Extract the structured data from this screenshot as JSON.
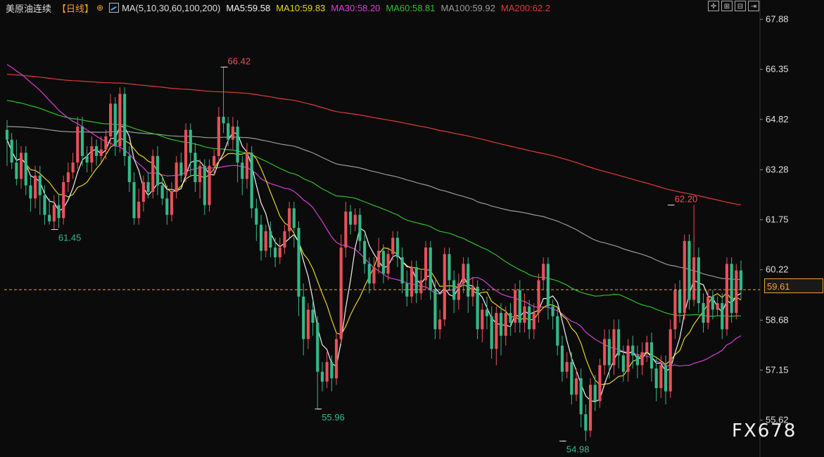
{
  "legend": {
    "symbol": "美原油连续",
    "period": "【日线】",
    "ma_label": "MA(5,10,30,60,100,200)",
    "ma5": "MA5:59.58",
    "ma10": "MA10:59.83",
    "ma30": "MA30:58.20",
    "ma60": "MA60:58.81",
    "ma100": "MA100:59.92",
    "ma200": "MA200:62.2"
  },
  "colors": {
    "background": "#0b0b0b",
    "up": "#e8505b",
    "down": "#34b888",
    "ma5": "#f2f2f2",
    "ma10": "#e6d320",
    "ma30": "#d63fd6",
    "ma60": "#2fbf2f",
    "ma100": "#9a9a9a",
    "ma200": "#e03a3a",
    "current_price": "#f0a030"
  },
  "current_price": "59.61",
  "watermark": "FX678",
  "chart_data": {
    "type": "candlestick",
    "ylim": [
      54.6,
      68.3
    ],
    "y_ticks": [
      "67.88",
      "66.35",
      "64.82",
      "63.28",
      "61.75",
      "60.22",
      "58.68",
      "57.15",
      "55.62"
    ],
    "current_price": 59.61,
    "annotations": [
      {
        "text": "66.42",
        "index": 46,
        "value": 66.42,
        "kind": "high"
      },
      {
        "text": "61.45",
        "index": 10,
        "value": 61.45,
        "kind": "low"
      },
      {
        "text": "55.96",
        "index": 66,
        "value": 55.96,
        "kind": "low"
      },
      {
        "text": "54.98",
        "index": 118,
        "value": 54.98,
        "kind": "low"
      },
      {
        "text": "62.20",
        "index": 141,
        "value": 62.2,
        "kind": "high"
      }
    ],
    "candles": [
      [
        64.5,
        64.2,
        64.8,
        63.4
      ],
      [
        64.2,
        63.5,
        64.4,
        63.3
      ],
      [
        63.5,
        63.0,
        64.2,
        62.8
      ],
      [
        63.0,
        63.8,
        64.0,
        62.7
      ],
      [
        63.8,
        62.8,
        64.0,
        62.5
      ],
      [
        62.8,
        62.4,
        63.1,
        62.0
      ],
      [
        62.4,
        63.1,
        63.4,
        62.1
      ],
      [
        63.1,
        62.5,
        63.4,
        61.9
      ],
      [
        62.5,
        61.9,
        62.8,
        61.6
      ],
      [
        61.9,
        61.7,
        62.4,
        61.6
      ],
      [
        61.7,
        62.2,
        62.5,
        61.45
      ],
      [
        62.2,
        61.8,
        62.5,
        61.5
      ],
      [
        61.8,
        62.9,
        63.1,
        61.6
      ],
      [
        62.9,
        63.2,
        63.5,
        62.6
      ],
      [
        63.2,
        63.5,
        63.8,
        63.0
      ],
      [
        63.5,
        64.6,
        64.9,
        63.3
      ],
      [
        64.6,
        63.7,
        64.9,
        63.4
      ],
      [
        63.7,
        63.5,
        64.0,
        63.2
      ],
      [
        63.5,
        64.0,
        64.3,
        63.2
      ],
      [
        64.0,
        63.7,
        64.2,
        63.4
      ],
      [
        63.7,
        63.9,
        64.3,
        63.5
      ],
      [
        63.9,
        64.3,
        64.5,
        63.6
      ],
      [
        64.3,
        65.3,
        65.6,
        64.0
      ],
      [
        65.3,
        64.0,
        65.5,
        63.7
      ],
      [
        64.0,
        65.6,
        65.8,
        63.8
      ],
      [
        65.6,
        63.7,
        65.8,
        63.4
      ],
      [
        63.7,
        62.9,
        64.0,
        62.6
      ],
      [
        62.9,
        61.8,
        63.2,
        61.6
      ],
      [
        61.8,
        62.3,
        62.7,
        61.6
      ],
      [
        62.3,
        62.9,
        63.1,
        62.0
      ],
      [
        62.9,
        62.6,
        63.2,
        62.4
      ],
      [
        62.6,
        63.7,
        63.9,
        62.4
      ],
      [
        63.7,
        62.8,
        64.0,
        62.5
      ],
      [
        62.8,
        62.4,
        63.1,
        62.2
      ],
      [
        62.4,
        61.9,
        62.8,
        61.6
      ],
      [
        61.9,
        62.6,
        62.9,
        61.7
      ],
      [
        62.6,
        63.5,
        63.7,
        62.4
      ],
      [
        63.5,
        63.1,
        63.8,
        62.9
      ],
      [
        63.1,
        64.5,
        64.7,
        62.9
      ],
      [
        64.5,
        63.8,
        64.7,
        63.1
      ],
      [
        63.8,
        62.9,
        64.1,
        62.6
      ],
      [
        62.9,
        63.4,
        63.6,
        62.4
      ],
      [
        63.4,
        62.2,
        63.6,
        61.9
      ],
      [
        62.2,
        63.4,
        63.6,
        62.0
      ],
      [
        63.4,
        63.7,
        63.9,
        63.1
      ],
      [
        63.7,
        64.9,
        65.2,
        63.5
      ],
      [
        64.9,
        64.7,
        66.42,
        64.4
      ],
      [
        64.7,
        64.2,
        64.9,
        64.0
      ],
      [
        64.2,
        64.6,
        64.9,
        63.9
      ],
      [
        64.6,
        63.5,
        64.8,
        62.9
      ],
      [
        63.5,
        63.0,
        63.7,
        62.5
      ],
      [
        63.0,
        63.8,
        64.1,
        62.7
      ],
      [
        63.8,
        62.1,
        64.0,
        61.8
      ],
      [
        62.1,
        61.6,
        62.4,
        61.1
      ],
      [
        61.6,
        60.8,
        61.9,
        60.5
      ],
      [
        60.8,
        61.4,
        61.6,
        60.6
      ],
      [
        61.4,
        60.9,
        61.7,
        60.6
      ],
      [
        60.9,
        60.6,
        61.2,
        60.3
      ],
      [
        60.6,
        60.9,
        61.2,
        60.4
      ],
      [
        60.9,
        61.4,
        61.6,
        60.7
      ],
      [
        61.4,
        62.1,
        62.3,
        61.2
      ],
      [
        62.1,
        61.5,
        62.3,
        60.9
      ],
      [
        61.5,
        59.4,
        61.7,
        58.8
      ],
      [
        59.4,
        58.1,
        59.8,
        57.6
      ],
      [
        58.1,
        59.0,
        59.2,
        57.8
      ],
      [
        59.0,
        58.6,
        59.3,
        58.2
      ],
      [
        58.6,
        57.1,
        58.8,
        55.96
      ],
      [
        57.1,
        56.8,
        57.4,
        56.5
      ],
      [
        56.8,
        57.4,
        57.7,
        56.6
      ],
      [
        57.4,
        56.9,
        57.6,
        56.5
      ],
      [
        56.9,
        58.1,
        58.3,
        56.7
      ],
      [
        58.1,
        60.9,
        61.3,
        57.9
      ],
      [
        60.9,
        62.0,
        62.3,
        60.6
      ],
      [
        62.0,
        61.6,
        62.2,
        61.3
      ],
      [
        61.6,
        61.9,
        62.1,
        61.4
      ],
      [
        61.9,
        61.1,
        62.1,
        60.8
      ],
      [
        61.1,
        60.4,
        61.3,
        60.1
      ],
      [
        60.4,
        59.8,
        60.6,
        59.5
      ],
      [
        59.8,
        60.3,
        60.6,
        59.6
      ],
      [
        60.3,
        60.8,
        61.2,
        60.1
      ],
      [
        60.8,
        60.1,
        61.0,
        59.8
      ],
      [
        60.1,
        60.7,
        60.9,
        59.9
      ],
      [
        60.7,
        61.2,
        61.4,
        60.5
      ],
      [
        61.2,
        60.6,
        61.4,
        60.3
      ],
      [
        60.6,
        59.8,
        60.9,
        59.5
      ],
      [
        59.8,
        59.4,
        60.2,
        59.1
      ],
      [
        59.4,
        60.3,
        60.5,
        59.2
      ],
      [
        60.3,
        59.5,
        60.5,
        59.2
      ],
      [
        59.5,
        59.9,
        60.2,
        59.3
      ],
      [
        59.9,
        60.9,
        61.1,
        59.6
      ],
      [
        60.9,
        59.6,
        61.1,
        59.3
      ],
      [
        59.6,
        58.4,
        59.9,
        58.1
      ],
      [
        58.4,
        58.7,
        59.0,
        58.1
      ],
      [
        58.7,
        60.7,
        60.9,
        58.5
      ],
      [
        60.7,
        59.9,
        60.9,
        59.6
      ],
      [
        59.9,
        59.3,
        60.2,
        58.9
      ],
      [
        59.3,
        59.8,
        60.1,
        59.0
      ],
      [
        59.8,
        60.4,
        60.6,
        59.5
      ],
      [
        60.4,
        59.4,
        60.6,
        58.9
      ],
      [
        59.4,
        59.7,
        60.0,
        59.1
      ],
      [
        59.7,
        58.4,
        59.9,
        58.1
      ],
      [
        58.4,
        59.0,
        59.2,
        58.0
      ],
      [
        59.0,
        58.8,
        59.4,
        58.4
      ],
      [
        58.8,
        57.8,
        59.1,
        57.5
      ],
      [
        57.8,
        58.9,
        59.1,
        57.3
      ],
      [
        58.9,
        58.2,
        59.2,
        57.6
      ],
      [
        58.2,
        58.9,
        59.1,
        57.9
      ],
      [
        58.9,
        58.6,
        59.2,
        58.2
      ],
      [
        58.6,
        59.6,
        59.8,
        58.3
      ],
      [
        59.6,
        58.6,
        59.9,
        58.3
      ],
      [
        58.6,
        59.1,
        59.5,
        58.3
      ],
      [
        59.1,
        58.4,
        59.3,
        58.1
      ],
      [
        58.4,
        58.9,
        59.2,
        58.1
      ],
      [
        58.9,
        59.9,
        60.1,
        58.6
      ],
      [
        59.9,
        60.4,
        60.6,
        59.6
      ],
      [
        60.4,
        59.1,
        60.6,
        58.7
      ],
      [
        59.1,
        58.8,
        59.3,
        58.4
      ],
      [
        58.8,
        57.9,
        59.1,
        57.6
      ],
      [
        57.9,
        57.1,
        58.2,
        56.8
      ],
      [
        57.1,
        57.4,
        57.7,
        56.9
      ],
      [
        57.4,
        56.4,
        57.7,
        56.1
      ],
      [
        56.4,
        56.9,
        57.2,
        56.2
      ],
      [
        56.9,
        55.8,
        57.2,
        55.4
      ],
      [
        55.8,
        55.3,
        56.1,
        54.98
      ],
      [
        55.3,
        56.7,
        56.9,
        55.1
      ],
      [
        56.7,
        56.2,
        57.0,
        55.9
      ],
      [
        56.2,
        57.3,
        57.5,
        56.0
      ],
      [
        57.3,
        58.1,
        58.4,
        57.0
      ],
      [
        58.1,
        57.3,
        58.4,
        56.9
      ],
      [
        57.3,
        58.4,
        58.7,
        57.0
      ],
      [
        58.4,
        57.6,
        58.7,
        57.2
      ],
      [
        57.6,
        57.1,
        57.9,
        56.8
      ],
      [
        57.1,
        57.9,
        58.1,
        56.8
      ],
      [
        57.9,
        57.6,
        58.2,
        57.2
      ],
      [
        57.6,
        57.3,
        57.9,
        56.9
      ],
      [
        57.3,
        57.7,
        58.0,
        57.0
      ],
      [
        57.7,
        58.0,
        58.2,
        57.4
      ],
      [
        58.0,
        57.2,
        58.3,
        56.8
      ],
      [
        57.2,
        56.6,
        57.5,
        56.2
      ],
      [
        56.6,
        57.3,
        57.6,
        56.3
      ],
      [
        57.3,
        56.5,
        57.6,
        56.1
      ],
      [
        56.5,
        58.4,
        58.7,
        56.3
      ],
      [
        58.4,
        59.6,
        59.8,
        58.1
      ],
      [
        59.6,
        58.9,
        59.9,
        58.6
      ],
      [
        58.9,
        61.1,
        61.3,
        58.7
      ],
      [
        61.1,
        59.3,
        61.3,
        59.0
      ],
      [
        59.3,
        60.6,
        62.2,
        59.1
      ],
      [
        60.6,
        59.2,
        60.9,
        58.9
      ],
      [
        59.2,
        58.6,
        59.5,
        58.3
      ],
      [
        58.6,
        59.4,
        59.6,
        58.4
      ],
      [
        59.4,
        59.0,
        59.6,
        58.7
      ],
      [
        59.0,
        59.2,
        59.4,
        58.8
      ],
      [
        59.2,
        58.4,
        59.5,
        58.1
      ],
      [
        58.4,
        60.4,
        60.6,
        58.2
      ],
      [
        60.4,
        58.9,
        60.6,
        58.6
      ],
      [
        58.9,
        60.2,
        60.4,
        58.7
      ],
      [
        60.2,
        59.6,
        60.5,
        59.3
      ]
    ]
  }
}
